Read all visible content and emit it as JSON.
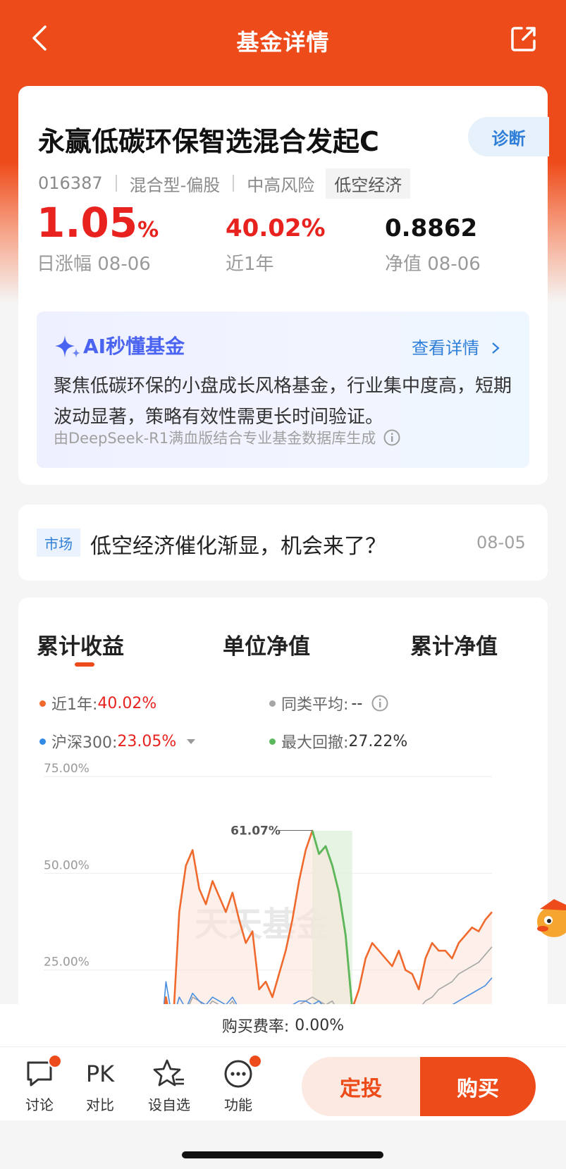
{
  "header": {
    "title": "基金详情"
  },
  "fund": {
    "name": "永赢低碳环保智选混合发起C",
    "diagnose_label": "诊断",
    "code": "016387",
    "type": "混合型-偏股",
    "risk": "中高风险",
    "theme_tag": "低空经济",
    "daily_change": "1.05",
    "daily_change_unit": "%",
    "daily_change_label": "日涨幅 08-06",
    "year_return": "40.02%",
    "year_return_label": "近1年",
    "nav": "0.8862",
    "nav_label": "净值 08-06"
  },
  "ai": {
    "title": "AI秒懂基金",
    "more_label": "查看详情",
    "summary": "聚焦低碳环保的小盘成长风格基金，行业集中度高，短期波动显著，策略有效性需更长时间验证。",
    "footer": "由DeepSeek-R1满血版结合专业基金数据库生成"
  },
  "news": {
    "tag": "市场",
    "title": "低空经济催化渐显，机会来了？",
    "date": "08-05"
  },
  "tabs": [
    "累计收益",
    "单位净值",
    "累计净值"
  ],
  "legend": {
    "fund_label": "近1年:",
    "fund_value": "40.02%",
    "peer_label": "同类平均:",
    "peer_value": "--",
    "index_label": "沪深300:",
    "index_value": "23.05%",
    "drawdown_label": "最大回撤:",
    "drawdown_value": "27.22%"
  },
  "watermark": "天天基金",
  "chart_data": {
    "type": "line",
    "y_ticks": [
      "75.00%",
      "50.00%",
      "25.00%"
    ],
    "peak_label": "61.07%",
    "ylim": [
      0,
      75
    ],
    "x": [
      0,
      2,
      4,
      6,
      8,
      10,
      12,
      14,
      16,
      18,
      20,
      22,
      24,
      26,
      28,
      30,
      32,
      34,
      36,
      38,
      40,
      42,
      44,
      46,
      48,
      50,
      52,
      54,
      56,
      58,
      60,
      62,
      64,
      66,
      68,
      70,
      72,
      74,
      76,
      78,
      80,
      82,
      84,
      86,
      88,
      90,
      92,
      94,
      96,
      98,
      100
    ],
    "series": [
      {
        "name": "近1年",
        "color": "#f06a2d",
        "values": [
          3,
          18,
          9,
          40,
          52,
          56,
          46,
          42,
          48,
          44,
          40,
          45,
          38,
          32,
          35,
          20,
          22,
          18,
          24,
          30,
          38,
          48,
          56,
          61,
          55,
          57,
          52,
          45,
          34,
          15,
          20,
          28,
          32,
          30,
          28,
          26,
          30,
          25,
          24,
          20,
          28,
          32,
          30,
          30,
          28,
          32,
          34,
          36,
          35,
          38,
          40
        ]
      },
      {
        "name": "同类平均",
        "color": "#a6a6a6",
        "values": [
          2,
          14,
          10,
          16,
          14,
          18,
          17,
          15,
          17,
          16,
          15,
          17,
          14,
          12,
          13,
          12,
          13,
          12,
          13,
          14,
          15,
          16,
          17,
          18,
          17,
          16,
          17,
          14,
          12,
          3,
          6,
          8,
          10,
          11,
          12,
          12,
          13,
          13,
          14,
          15,
          17,
          18,
          20,
          21,
          22,
          24,
          25,
          26,
          27,
          29,
          31
        ]
      },
      {
        "name": "沪深300",
        "color": "#4a8ee0",
        "values": [
          2,
          22,
          12,
          18,
          15,
          19,
          17,
          16,
          18,
          17,
          16,
          18,
          15,
          13,
          14,
          13,
          15,
          14,
          14,
          15,
          16,
          17,
          17,
          16,
          17,
          15,
          16,
          13,
          10,
          2,
          4,
          5,
          7,
          8,
          9,
          9,
          10,
          10,
          11,
          11,
          12,
          13,
          14,
          15,
          16,
          17,
          18,
          19,
          20,
          21,
          23
        ]
      }
    ],
    "drawdown_region": [
      46,
      58
    ],
    "drawdown_color": "#5cb85c"
  },
  "fee": {
    "label": "购买费率:",
    "value": "0.00%"
  },
  "toolbar": {
    "discuss": "讨论",
    "compare_icon": "PK",
    "compare": "对比",
    "watchlist": "设自选",
    "functions": "功能",
    "plan_label": "定投",
    "buy_label": "购买"
  }
}
